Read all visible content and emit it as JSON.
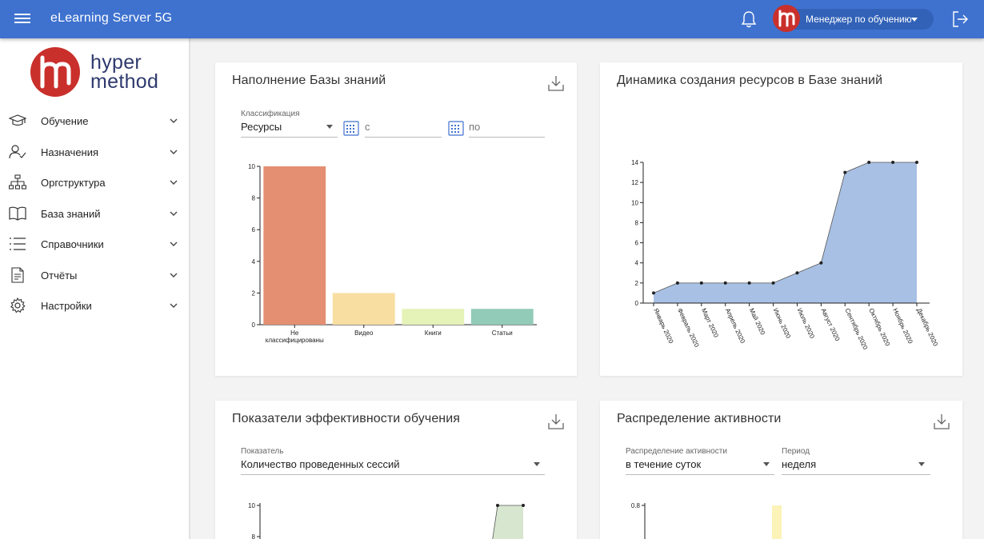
{
  "header": {
    "app_title": "eLearning Server 5G",
    "user_name": "Менеджер по обучению"
  },
  "sidebar": {
    "logo_line1": "hyper",
    "logo_line2": "method",
    "items": [
      {
        "label": "Обучение",
        "icon": "graduation-cap-icon"
      },
      {
        "label": "Назначения",
        "icon": "user-check-icon"
      },
      {
        "label": "Оргструктура",
        "icon": "org-chart-icon"
      },
      {
        "label": "База знаний",
        "icon": "book-icon"
      },
      {
        "label": "Справочники",
        "icon": "list-icon"
      },
      {
        "label": "Отчёты",
        "icon": "report-icon"
      },
      {
        "label": "Настройки",
        "icon": "gear-icon"
      }
    ]
  },
  "cards": {
    "kb_fill": {
      "title": "Наполнение Базы знаний",
      "classification_label": "Классификация",
      "classification_value": "Ресурсы",
      "from_placeholder": "с",
      "to_placeholder": "по"
    },
    "kb_dynamics": {
      "title": "Динамика создания ресурсов в Базе знаний"
    },
    "efficiency": {
      "title": "Показатели эффективности обучения",
      "indicator_label": "Показатель",
      "indicator_value": "Количество проведенных сессий"
    },
    "activity": {
      "title": "Распределение активности",
      "distribution_label": "Распределение активности",
      "distribution_value": "в течение суток",
      "period_label": "Период",
      "period_value": "неделя"
    }
  },
  "chart_data": [
    {
      "type": "bar",
      "categories": [
        "Не классифицированы",
        "Видео",
        "Книги",
        "Статьи"
      ],
      "values": [
        10,
        2,
        1,
        1
      ],
      "colors": [
        "#e58f72",
        "#f9dea2",
        "#e5f2b8",
        "#92cbb7"
      ],
      "ylim": [
        0,
        10
      ],
      "yticks": [
        0,
        2,
        4,
        6,
        8,
        10
      ]
    },
    {
      "type": "area",
      "categories": [
        "Январь 2020",
        "Февраль 2020",
        "Март 2020",
        "Апрель 2020",
        "Май 2020",
        "Июнь 2020",
        "Июль 2020",
        "Август 2020",
        "Сентябрь 2020",
        "Октябрь 2020",
        "Ноябрь 2020",
        "Декабрь 2020"
      ],
      "values": [
        1,
        2,
        2,
        2,
        2,
        2,
        3,
        4,
        13,
        14,
        14,
        14
      ],
      "color": "#a8c0e4",
      "ylim": [
        0,
        14
      ],
      "yticks": [
        0,
        2,
        4,
        6,
        8,
        10,
        12,
        14
      ]
    },
    {
      "type": "area",
      "partial": true,
      "visible_ticks": [
        10,
        8
      ],
      "visible_values": [
        10,
        10
      ],
      "color": "#d6e6cf"
    },
    {
      "type": "bar",
      "partial": true,
      "visible_ticks": [
        0.8
      ],
      "visible_values": [
        0.8
      ],
      "color": "#fbf3b8"
    }
  ]
}
